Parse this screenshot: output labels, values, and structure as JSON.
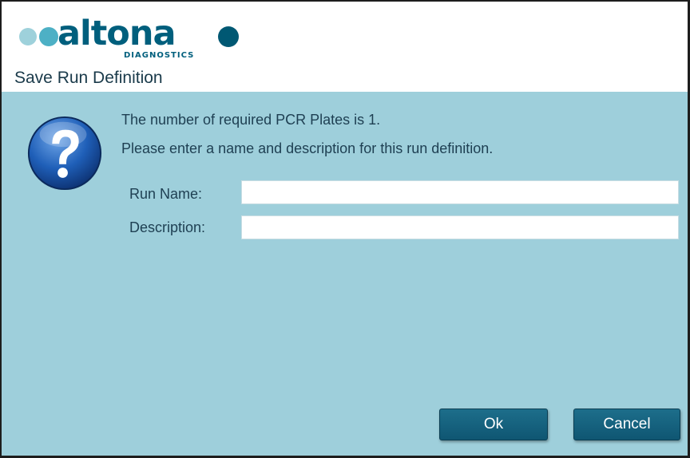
{
  "brand": {
    "name": "altona",
    "subtitle": "DIAGNOSTICS",
    "colors": {
      "dot_light": "#9ed1db",
      "dot_mid": "#4db0c5",
      "dot_dark": "#005873",
      "text": "#005f7d"
    }
  },
  "dialog": {
    "title": "Save Run Definition",
    "icon": "question-icon",
    "message_line1": "The number of required PCR Plates is 1.",
    "message_line2": "Please enter a name and description for this run definition.",
    "fields": {
      "run_name": {
        "label": "Run Name:",
        "value": "",
        "placeholder": ""
      },
      "description": {
        "label": "Description:",
        "value": "",
        "placeholder": ""
      }
    },
    "buttons": {
      "ok": "Ok",
      "cancel": "Cancel"
    },
    "colors": {
      "body_bg": "#9ecfdb",
      "button_bg": "#135f7b",
      "text": "#1e3f52"
    }
  }
}
